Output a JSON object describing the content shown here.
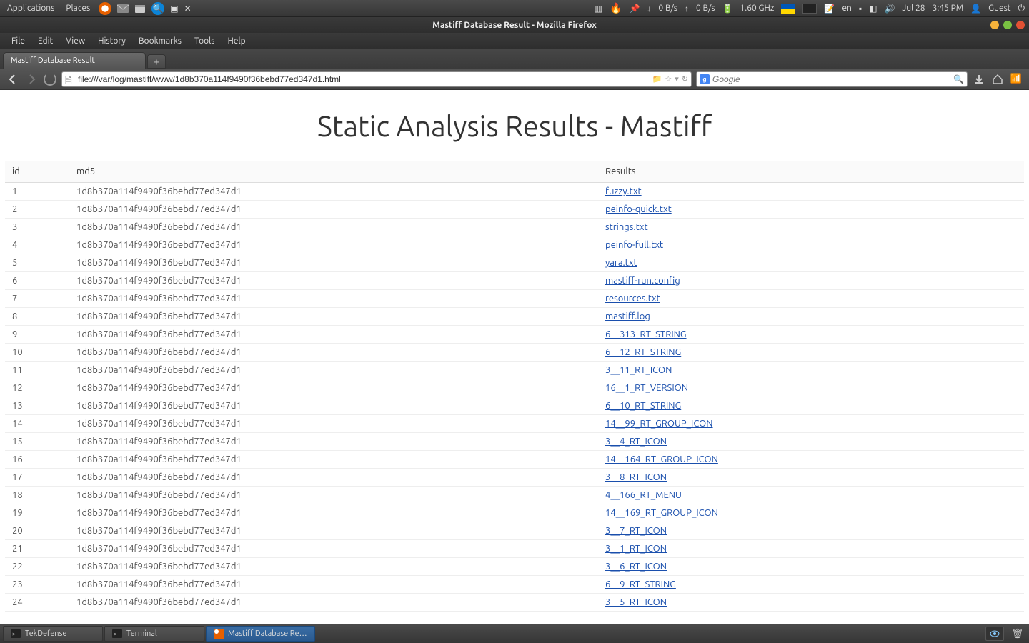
{
  "topPanel": {
    "applications": "Applications",
    "places": "Places",
    "netDown": "0 B/s",
    "netUp": "0 B/s",
    "cpu": "1.60 GHz",
    "lang": "en",
    "date": "Jul 28",
    "time": "3:45 PM",
    "user": "Guest"
  },
  "window": {
    "title": "Mastiff Database Result - Mozilla Firefox"
  },
  "menubar": {
    "file": "File",
    "edit": "Edit",
    "view": "View",
    "history": "History",
    "bookmarks": "Bookmarks",
    "tools": "Tools",
    "help": "Help"
  },
  "tab": {
    "title": "Mastiff Database Result"
  },
  "nav": {
    "url": "file:///var/log/mastiff/www/1d8b370a114f9490f36bebd77ed347d1.html",
    "searchPlaceholder": "Google"
  },
  "page": {
    "heading": "Static Analysis Results - Mastiff",
    "columns": {
      "id": "id",
      "md5": "md5",
      "results": "Results"
    },
    "md5": "1d8b370a114f9490f36bebd77ed347d1",
    "rows": [
      {
        "id": "1",
        "result": "fuzzy.txt"
      },
      {
        "id": "2",
        "result": "peinfo-quick.txt"
      },
      {
        "id": "3",
        "result": "strings.txt"
      },
      {
        "id": "4",
        "result": "peinfo-full.txt"
      },
      {
        "id": "5",
        "result": "yara.txt"
      },
      {
        "id": "6",
        "result": "mastiff-run.config"
      },
      {
        "id": "7",
        "result": "resources.txt"
      },
      {
        "id": "8",
        "result": "mastiff.log"
      },
      {
        "id": "9",
        "result": "6__313_RT_STRING"
      },
      {
        "id": "10",
        "result": "6__12_RT_STRING"
      },
      {
        "id": "11",
        "result": "3__11_RT_ICON"
      },
      {
        "id": "12",
        "result": "16__1_RT_VERSION"
      },
      {
        "id": "13",
        "result": "6__10_RT_STRING"
      },
      {
        "id": "14",
        "result": "14__99_RT_GROUP_ICON"
      },
      {
        "id": "15",
        "result": "3__4_RT_ICON"
      },
      {
        "id": "16",
        "result": "14__164_RT_GROUP_ICON"
      },
      {
        "id": "17",
        "result": "3__8_RT_ICON"
      },
      {
        "id": "18",
        "result": "4__166_RT_MENU"
      },
      {
        "id": "19",
        "result": "14__169_RT_GROUP_ICON"
      },
      {
        "id": "20",
        "result": "3__7_RT_ICON"
      },
      {
        "id": "21",
        "result": "3__1_RT_ICON"
      },
      {
        "id": "22",
        "result": "3__6_RT_ICON"
      },
      {
        "id": "23",
        "result": "6__9_RT_STRING"
      },
      {
        "id": "24",
        "result": "3__5_RT_ICON"
      }
    ]
  },
  "taskbar": {
    "tekdefense": "TekDefense",
    "terminal": "Terminal",
    "firefox": "Mastiff Database Re…"
  }
}
